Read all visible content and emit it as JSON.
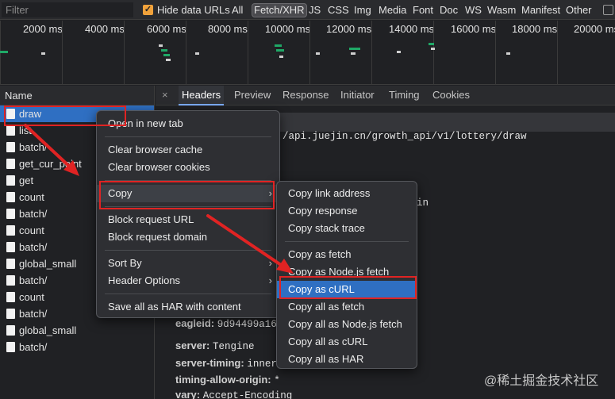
{
  "filterbar": {
    "placeholder": "Filter",
    "hide_data_urls": "Hide data URLs",
    "types": [
      "All",
      "Fetch/XHR",
      "JS",
      "CSS",
      "Img",
      "Media",
      "Font",
      "Doc",
      "WS",
      "Wasm",
      "Manifest",
      "Other"
    ]
  },
  "timeline": {
    "ticks": [
      "2000 ms",
      "4000 ms",
      "6000 ms",
      "8000 ms",
      "10000 ms",
      "12000 ms",
      "14000 ms",
      "16000 ms",
      "18000 ms",
      "20000 ms"
    ]
  },
  "names": {
    "header": "Name",
    "rows": [
      "draw",
      "list",
      "batch/",
      "get_cur_point",
      "get",
      "count",
      "batch/",
      "count",
      "batch/",
      "global_small",
      "batch/",
      "count",
      "batch/",
      "global_small",
      "batch/"
    ]
  },
  "details": {
    "close": "×",
    "tabs": [
      "Headers",
      "Preview",
      "Response",
      "Initiator",
      "Timing",
      "Cookies"
    ],
    "url_fragment": "/api.juejin.cn/growth_api/v1/lottery/draw",
    "partial_in": "in",
    "headers": [
      {
        "k": "eagleid:",
        "v": "9d94499a162"
      },
      {
        "k": "server:",
        "v": "Tengine"
      },
      {
        "k": "server-timing:",
        "v": "inner;"
      },
      {
        "k": "timing-allow-origin:",
        "v": "*"
      },
      {
        "k": "vary:",
        "v": "Accept-Encoding"
      }
    ]
  },
  "menu1": {
    "items": [
      "Open in new tab",
      "Clear browser cache",
      "Clear browser cookies",
      "Copy",
      "Block request URL",
      "Block request domain",
      "Sort By",
      "Header Options",
      "Save all as HAR with content"
    ]
  },
  "menu2": {
    "items": [
      "Copy link address",
      "Copy response",
      "Copy stack trace",
      "Copy as fetch",
      "Copy as Node.js fetch",
      "Copy as cURL",
      "Copy all as fetch",
      "Copy all as Node.js fetch",
      "Copy all as cURL",
      "Copy all as HAR"
    ]
  },
  "watermark": "@稀土掘金技术社区",
  "colors": {
    "accent": "#2f6fc2",
    "annotation": "#e02323",
    "checkbox": "#f0a23b"
  }
}
